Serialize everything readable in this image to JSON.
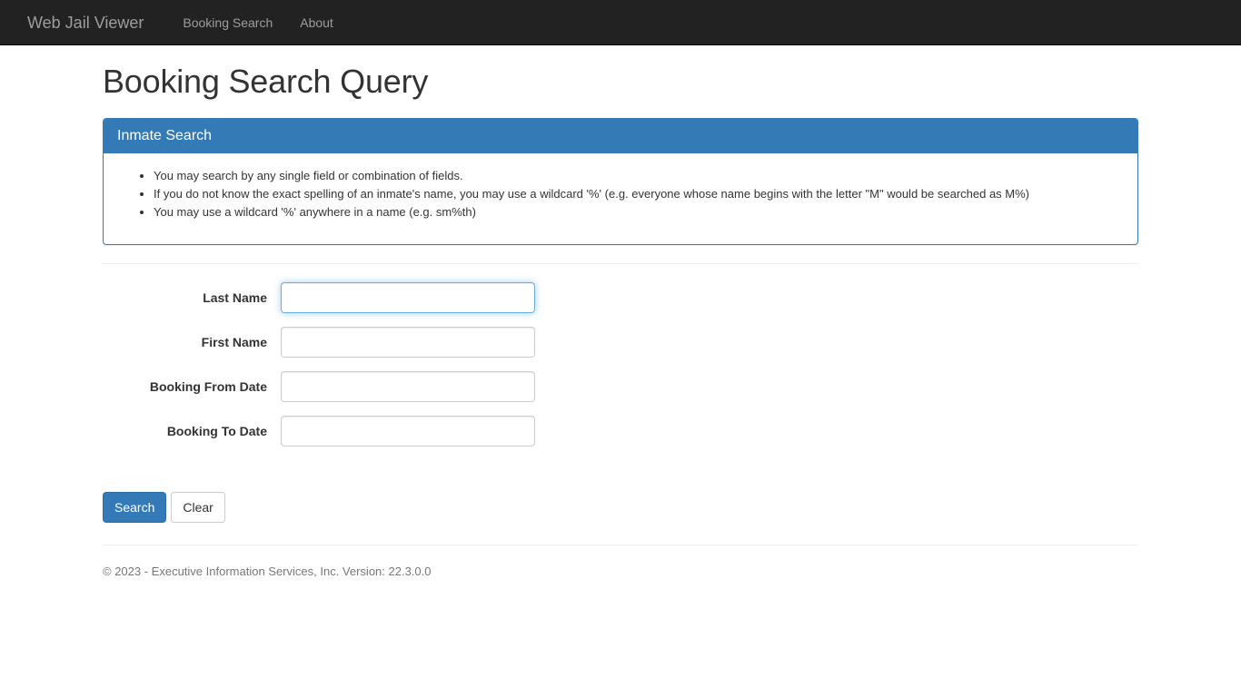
{
  "navbar": {
    "brand": "Web Jail Viewer",
    "links": [
      {
        "label": "Booking Search"
      },
      {
        "label": "About"
      }
    ]
  },
  "page": {
    "title": "Booking Search Query"
  },
  "panel": {
    "heading": "Inmate Search",
    "bullets": [
      "You may search by any single field or combination of fields.",
      "If you do not know the exact spelling of an inmate's name, you may use a wildcard '%' (e.g. everyone whose name begins with the letter \"M\" would be searched as M%)",
      "You may use a wildcard '%' anywhere in a name (e.g. sm%th)"
    ]
  },
  "form": {
    "fields": [
      {
        "label": "Last Name",
        "value": "",
        "placeholder": "",
        "focused": true
      },
      {
        "label": "First Name",
        "value": "",
        "placeholder": "",
        "focused": false
      },
      {
        "label": "Booking From Date",
        "value": "",
        "placeholder": "",
        "focused": false
      },
      {
        "label": "Booking To Date",
        "value": "",
        "placeholder": "",
        "focused": false
      }
    ],
    "buttons": {
      "search": "Search",
      "clear": "Clear"
    }
  },
  "footer": {
    "text": "© 2023 - Executive Information Services, Inc. Version: 22.3.0.0"
  },
  "colors": {
    "navbar_bg": "#222222",
    "navbar_link": "#9d9d9d",
    "primary": "#337ab7",
    "primary_border": "#2e6da4",
    "focus_border": "#66afe9",
    "text": "#333333",
    "muted": "#777777",
    "input_border": "#cccccc",
    "rule": "#eeeeee"
  }
}
